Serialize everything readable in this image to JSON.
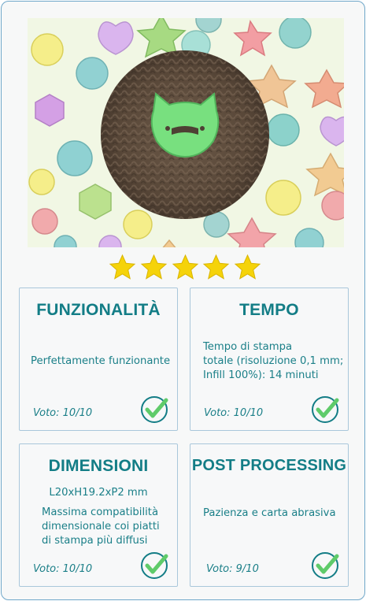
{
  "rating": {
    "stars_filled": 5,
    "stars_total": 5,
    "star_color": "#f5d30a"
  },
  "colors": {
    "accent": "#137d86",
    "border": "#a9c7db",
    "check": "#5fcb6a"
  },
  "cards": [
    {
      "title": "FUNZIONALITÀ",
      "lines": [
        "Perfettamente funzionante"
      ],
      "vote": "Voto: 10/10"
    },
    {
      "title": "TEMPO",
      "lines": [
        "Tempo di stampa",
        "totale (risoluzione 0,1 mm;",
        "Infill 100%): 14 minuti"
      ],
      "vote": "Voto: 10/10"
    },
    {
      "title": "DIMENSIONI",
      "subtitle": "L20xH19.2xP2 mm",
      "lines": [
        "Massima compatibilità",
        "dimensionale coi piatti",
        "di stampa più diffusi"
      ],
      "vote": "Voto: 10/10"
    },
    {
      "title": "POST PROCESSING",
      "lines": [
        "Pazienza e carta abrasiva"
      ],
      "vote": "Voto: 9/10"
    }
  ]
}
